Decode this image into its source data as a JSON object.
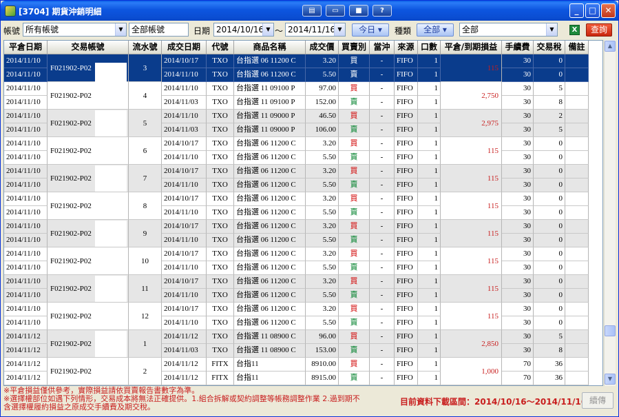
{
  "window": {
    "title": "[3704] 期貨沖銷明細",
    "toolbar_icons": [
      "layout-icon",
      "window-icon",
      "camera-icon",
      "help-icon"
    ],
    "help_label": "?"
  },
  "filters": {
    "account_label": "帳號",
    "account_value": "所有帳號",
    "account_text": "全部帳號",
    "date_label": "日期",
    "date_from": "2014/10/16",
    "date_sep": "～",
    "date_to": "2014/11/16",
    "today_button": "今日",
    "type_label": "種類",
    "type_button": "全部",
    "type_value": "全部",
    "query_button": "查詢"
  },
  "columns": [
    "平倉日期",
    "交易帳號",
    "流水號",
    "成交日期",
    "代號",
    "商品名稱",
    "成交價",
    "買賣別",
    "當沖",
    "來源",
    "口數",
    "平倉/到期損益",
    "手續費",
    "交易稅",
    "備註"
  ],
  "groups": [
    {
      "account": "F021902-P02",
      "serial": "3",
      "pnl": "115",
      "rows": [
        {
          "close_date": "2014/11/10",
          "trade_date": "2014/10/17",
          "code": "TXO",
          "product": "台指選 06 11200 C",
          "price": "3.20",
          "side": "買",
          "day_trade": "-",
          "source": "FIFO",
          "qty": "1",
          "fee": "30",
          "tax": "0"
        },
        {
          "close_date": "2014/11/10",
          "trade_date": "2014/11/10",
          "code": "TXO",
          "product": "台指選 06 11200 C",
          "price": "5.50",
          "side": "賣",
          "day_trade": "-",
          "source": "FIFO",
          "qty": "1",
          "fee": "30",
          "tax": "0"
        }
      ]
    },
    {
      "account": "F021902-P02",
      "serial": "4",
      "pnl": "2,750",
      "rows": [
        {
          "close_date": "2014/11/10",
          "trade_date": "2014/11/10",
          "code": "TXO",
          "product": "台指選 11 09100 P",
          "price": "97.00",
          "side": "買",
          "day_trade": "-",
          "source": "FIFO",
          "qty": "1",
          "fee": "30",
          "tax": "5"
        },
        {
          "close_date": "2014/11/10",
          "trade_date": "2014/11/03",
          "code": "TXO",
          "product": "台指選 11 09100 P",
          "price": "152.00",
          "side": "賣",
          "day_trade": "-",
          "source": "FIFO",
          "qty": "1",
          "fee": "30",
          "tax": "8"
        }
      ]
    },
    {
      "account": "F021902-P02",
      "serial": "5",
      "pnl": "2,975",
      "rows": [
        {
          "close_date": "2014/11/10",
          "trade_date": "2014/11/10",
          "code": "TXO",
          "product": "台指選 11 09000 P",
          "price": "46.50",
          "side": "買",
          "day_trade": "-",
          "source": "FIFO",
          "qty": "1",
          "fee": "30",
          "tax": "2"
        },
        {
          "close_date": "2014/11/10",
          "trade_date": "2014/11/03",
          "code": "TXO",
          "product": "台指選 11 09000 P",
          "price": "106.00",
          "side": "賣",
          "day_trade": "-",
          "source": "FIFO",
          "qty": "1",
          "fee": "30",
          "tax": "5"
        }
      ]
    },
    {
      "account": "F021902-P02",
      "serial": "6",
      "pnl": "115",
      "rows": [
        {
          "close_date": "2014/11/10",
          "trade_date": "2014/10/17",
          "code": "TXO",
          "product": "台指選 06 11200 C",
          "price": "3.20",
          "side": "買",
          "day_trade": "-",
          "source": "FIFO",
          "qty": "1",
          "fee": "30",
          "tax": "0"
        },
        {
          "close_date": "2014/11/10",
          "trade_date": "2014/11/10",
          "code": "TXO",
          "product": "台指選 06 11200 C",
          "price": "5.50",
          "side": "賣",
          "day_trade": "-",
          "source": "FIFO",
          "qty": "1",
          "fee": "30",
          "tax": "0"
        }
      ]
    },
    {
      "account": "F021902-P02",
      "serial": "7",
      "pnl": "115",
      "rows": [
        {
          "close_date": "2014/11/10",
          "trade_date": "2014/10/17",
          "code": "TXO",
          "product": "台指選 06 11200 C",
          "price": "3.20",
          "side": "買",
          "day_trade": "-",
          "source": "FIFO",
          "qty": "1",
          "fee": "30",
          "tax": "0"
        },
        {
          "close_date": "2014/11/10",
          "trade_date": "2014/11/10",
          "code": "TXO",
          "product": "台指選 06 11200 C",
          "price": "5.50",
          "side": "賣",
          "day_trade": "-",
          "source": "FIFO",
          "qty": "1",
          "fee": "30",
          "tax": "0"
        }
      ]
    },
    {
      "account": "F021902-P02",
      "serial": "8",
      "pnl": "115",
      "rows": [
        {
          "close_date": "2014/11/10",
          "trade_date": "2014/10/17",
          "code": "TXO",
          "product": "台指選 06 11200 C",
          "price": "3.20",
          "side": "買",
          "day_trade": "-",
          "source": "FIFO",
          "qty": "1",
          "fee": "30",
          "tax": "0"
        },
        {
          "close_date": "2014/11/10",
          "trade_date": "2014/11/10",
          "code": "TXO",
          "product": "台指選 06 11200 C",
          "price": "5.50",
          "side": "賣",
          "day_trade": "-",
          "source": "FIFO",
          "qty": "1",
          "fee": "30",
          "tax": "0"
        }
      ]
    },
    {
      "account": "F021902-P02",
      "serial": "9",
      "pnl": "115",
      "rows": [
        {
          "close_date": "2014/11/10",
          "trade_date": "2014/10/17",
          "code": "TXO",
          "product": "台指選 06 11200 C",
          "price": "3.20",
          "side": "買",
          "day_trade": "-",
          "source": "FIFO",
          "qty": "1",
          "fee": "30",
          "tax": "0"
        },
        {
          "close_date": "2014/11/10",
          "trade_date": "2014/11/10",
          "code": "TXO",
          "product": "台指選 06 11200 C",
          "price": "5.50",
          "side": "賣",
          "day_trade": "-",
          "source": "FIFO",
          "qty": "1",
          "fee": "30",
          "tax": "0"
        }
      ]
    },
    {
      "account": "F021902-P02",
      "serial": "10",
      "pnl": "115",
      "rows": [
        {
          "close_date": "2014/11/10",
          "trade_date": "2014/10/17",
          "code": "TXO",
          "product": "台指選 06 11200 C",
          "price": "3.20",
          "side": "買",
          "day_trade": "-",
          "source": "FIFO",
          "qty": "1",
          "fee": "30",
          "tax": "0"
        },
        {
          "close_date": "2014/11/10",
          "trade_date": "2014/11/10",
          "code": "TXO",
          "product": "台指選 06 11200 C",
          "price": "5.50",
          "side": "賣",
          "day_trade": "-",
          "source": "FIFO",
          "qty": "1",
          "fee": "30",
          "tax": "0"
        }
      ]
    },
    {
      "account": "F021902-P02",
      "serial": "11",
      "pnl": "115",
      "rows": [
        {
          "close_date": "2014/11/10",
          "trade_date": "2014/10/17",
          "code": "TXO",
          "product": "台指選 06 11200 C",
          "price": "3.20",
          "side": "買",
          "day_trade": "-",
          "source": "FIFO",
          "qty": "1",
          "fee": "30",
          "tax": "0"
        },
        {
          "close_date": "2014/11/10",
          "trade_date": "2014/11/10",
          "code": "TXO",
          "product": "台指選 06 11200 C",
          "price": "5.50",
          "side": "賣",
          "day_trade": "-",
          "source": "FIFO",
          "qty": "1",
          "fee": "30",
          "tax": "0"
        }
      ]
    },
    {
      "account": "F021902-P02",
      "serial": "12",
      "pnl": "115",
      "rows": [
        {
          "close_date": "2014/11/10",
          "trade_date": "2014/10/17",
          "code": "TXO",
          "product": "台指選 06 11200 C",
          "price": "3.20",
          "side": "買",
          "day_trade": "-",
          "source": "FIFO",
          "qty": "1",
          "fee": "30",
          "tax": "0"
        },
        {
          "close_date": "2014/11/10",
          "trade_date": "2014/11/10",
          "code": "TXO",
          "product": "台指選 06 11200 C",
          "price": "5.50",
          "side": "賣",
          "day_trade": "-",
          "source": "FIFO",
          "qty": "1",
          "fee": "30",
          "tax": "0"
        }
      ]
    },
    {
      "account": "F021902-P02",
      "serial": "1",
      "pnl": "2,850",
      "rows": [
        {
          "close_date": "2014/11/12",
          "trade_date": "2014/11/12",
          "code": "TXO",
          "product": "台指選 11 08900 C",
          "price": "96.00",
          "side": "買",
          "day_trade": "-",
          "source": "FIFO",
          "qty": "1",
          "fee": "30",
          "tax": "5"
        },
        {
          "close_date": "2014/11/12",
          "trade_date": "2014/11/03",
          "code": "TXO",
          "product": "台指選 11 08900 C",
          "price": "153.00",
          "side": "賣",
          "day_trade": "-",
          "source": "FIFO",
          "qty": "1",
          "fee": "30",
          "tax": "8"
        }
      ]
    },
    {
      "account": "F021902-P02",
      "serial": "2",
      "pnl": "1,000",
      "rows": [
        {
          "close_date": "2014/11/12",
          "trade_date": "2014/11/12",
          "code": "FITX",
          "product": "台指11",
          "price": "8910.00",
          "side": "買",
          "day_trade": "-",
          "source": "FIFO",
          "qty": "1",
          "fee": "70",
          "tax": "36"
        },
        {
          "close_date": "2014/11/12",
          "trade_date": "2014/11/12",
          "code": "FITX",
          "product": "台指11",
          "price": "8915.00",
          "side": "賣",
          "day_trade": "-",
          "source": "FIFO",
          "qty": "1",
          "fee": "70",
          "tax": "36"
        }
      ]
    }
  ],
  "footer": {
    "note1": "※平倉損益僅供參考，實際損益請依買賣報告書數字為準。",
    "note2": "※選擇權部位如遇下列情形，交易成本將無法正確提供。1.組合拆解或契約調整等帳務調整作業 2.過到期不",
    "note3": "含選擇權履約損益之原成交手續費及期交稅。",
    "range_label": "目前資料下載區間：2014/10/16～2014/11/16",
    "resend_button": "續傳"
  },
  "colors": {
    "title_bar": "#0a4cd0",
    "selected_row": "#0a3c8c",
    "buy": "#d10000",
    "sell": "#00802b",
    "pnl": "#c81e1e"
  }
}
